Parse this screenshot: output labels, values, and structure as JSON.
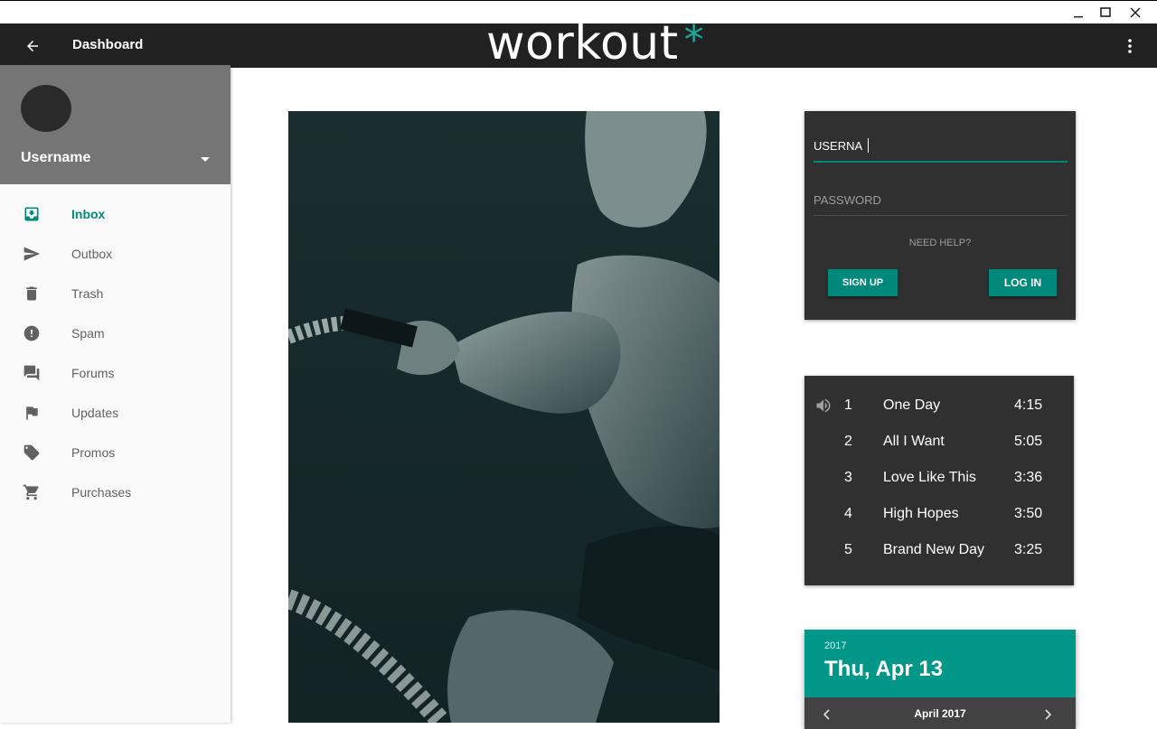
{
  "window": {
    "minimize_label": "—",
    "maximize_label": "☐",
    "close_label": "✕"
  },
  "appbar": {
    "title": "Dashboard",
    "logo_text": "workout",
    "logo_mark": "*"
  },
  "profile": {
    "username": "Username"
  },
  "nav": {
    "items": [
      {
        "label": "Inbox",
        "icon": "inbox-icon",
        "active": true
      },
      {
        "label": "Outbox",
        "icon": "send-icon"
      },
      {
        "label": "Trash",
        "icon": "trash-icon"
      },
      {
        "label": "Spam",
        "icon": "spam-icon"
      },
      {
        "label": "Forums",
        "icon": "forum-icon"
      },
      {
        "label": "Updates",
        "icon": "flag-icon"
      },
      {
        "label": "Promos",
        "icon": "tag-icon"
      },
      {
        "label": "Purchases",
        "icon": "cart-icon"
      }
    ]
  },
  "login": {
    "username_value": "USERNA",
    "password_placeholder": "PASSWORD",
    "help_text": "NEED HELP?",
    "signup_label": "SIGN UP",
    "login_label": "LOG IN"
  },
  "playlist": {
    "tracks": [
      {
        "num": "1",
        "title": "One Day",
        "duration": "4:15",
        "playing": true
      },
      {
        "num": "2",
        "title": "All I Want",
        "duration": "5:05"
      },
      {
        "num": "3",
        "title": "Love Like This",
        "duration": "3:36"
      },
      {
        "num": "4",
        "title": "High Hopes",
        "duration": "3:50"
      },
      {
        "num": "5",
        "title": "Brand New Day",
        "duration": "3:25"
      }
    ]
  },
  "datepicker": {
    "year": "2017",
    "date_label": "Thu, Apr 13",
    "month_label": "April 2017"
  },
  "colors": {
    "accent": "#00897b",
    "appbar": "#212121",
    "card": "#303030"
  }
}
